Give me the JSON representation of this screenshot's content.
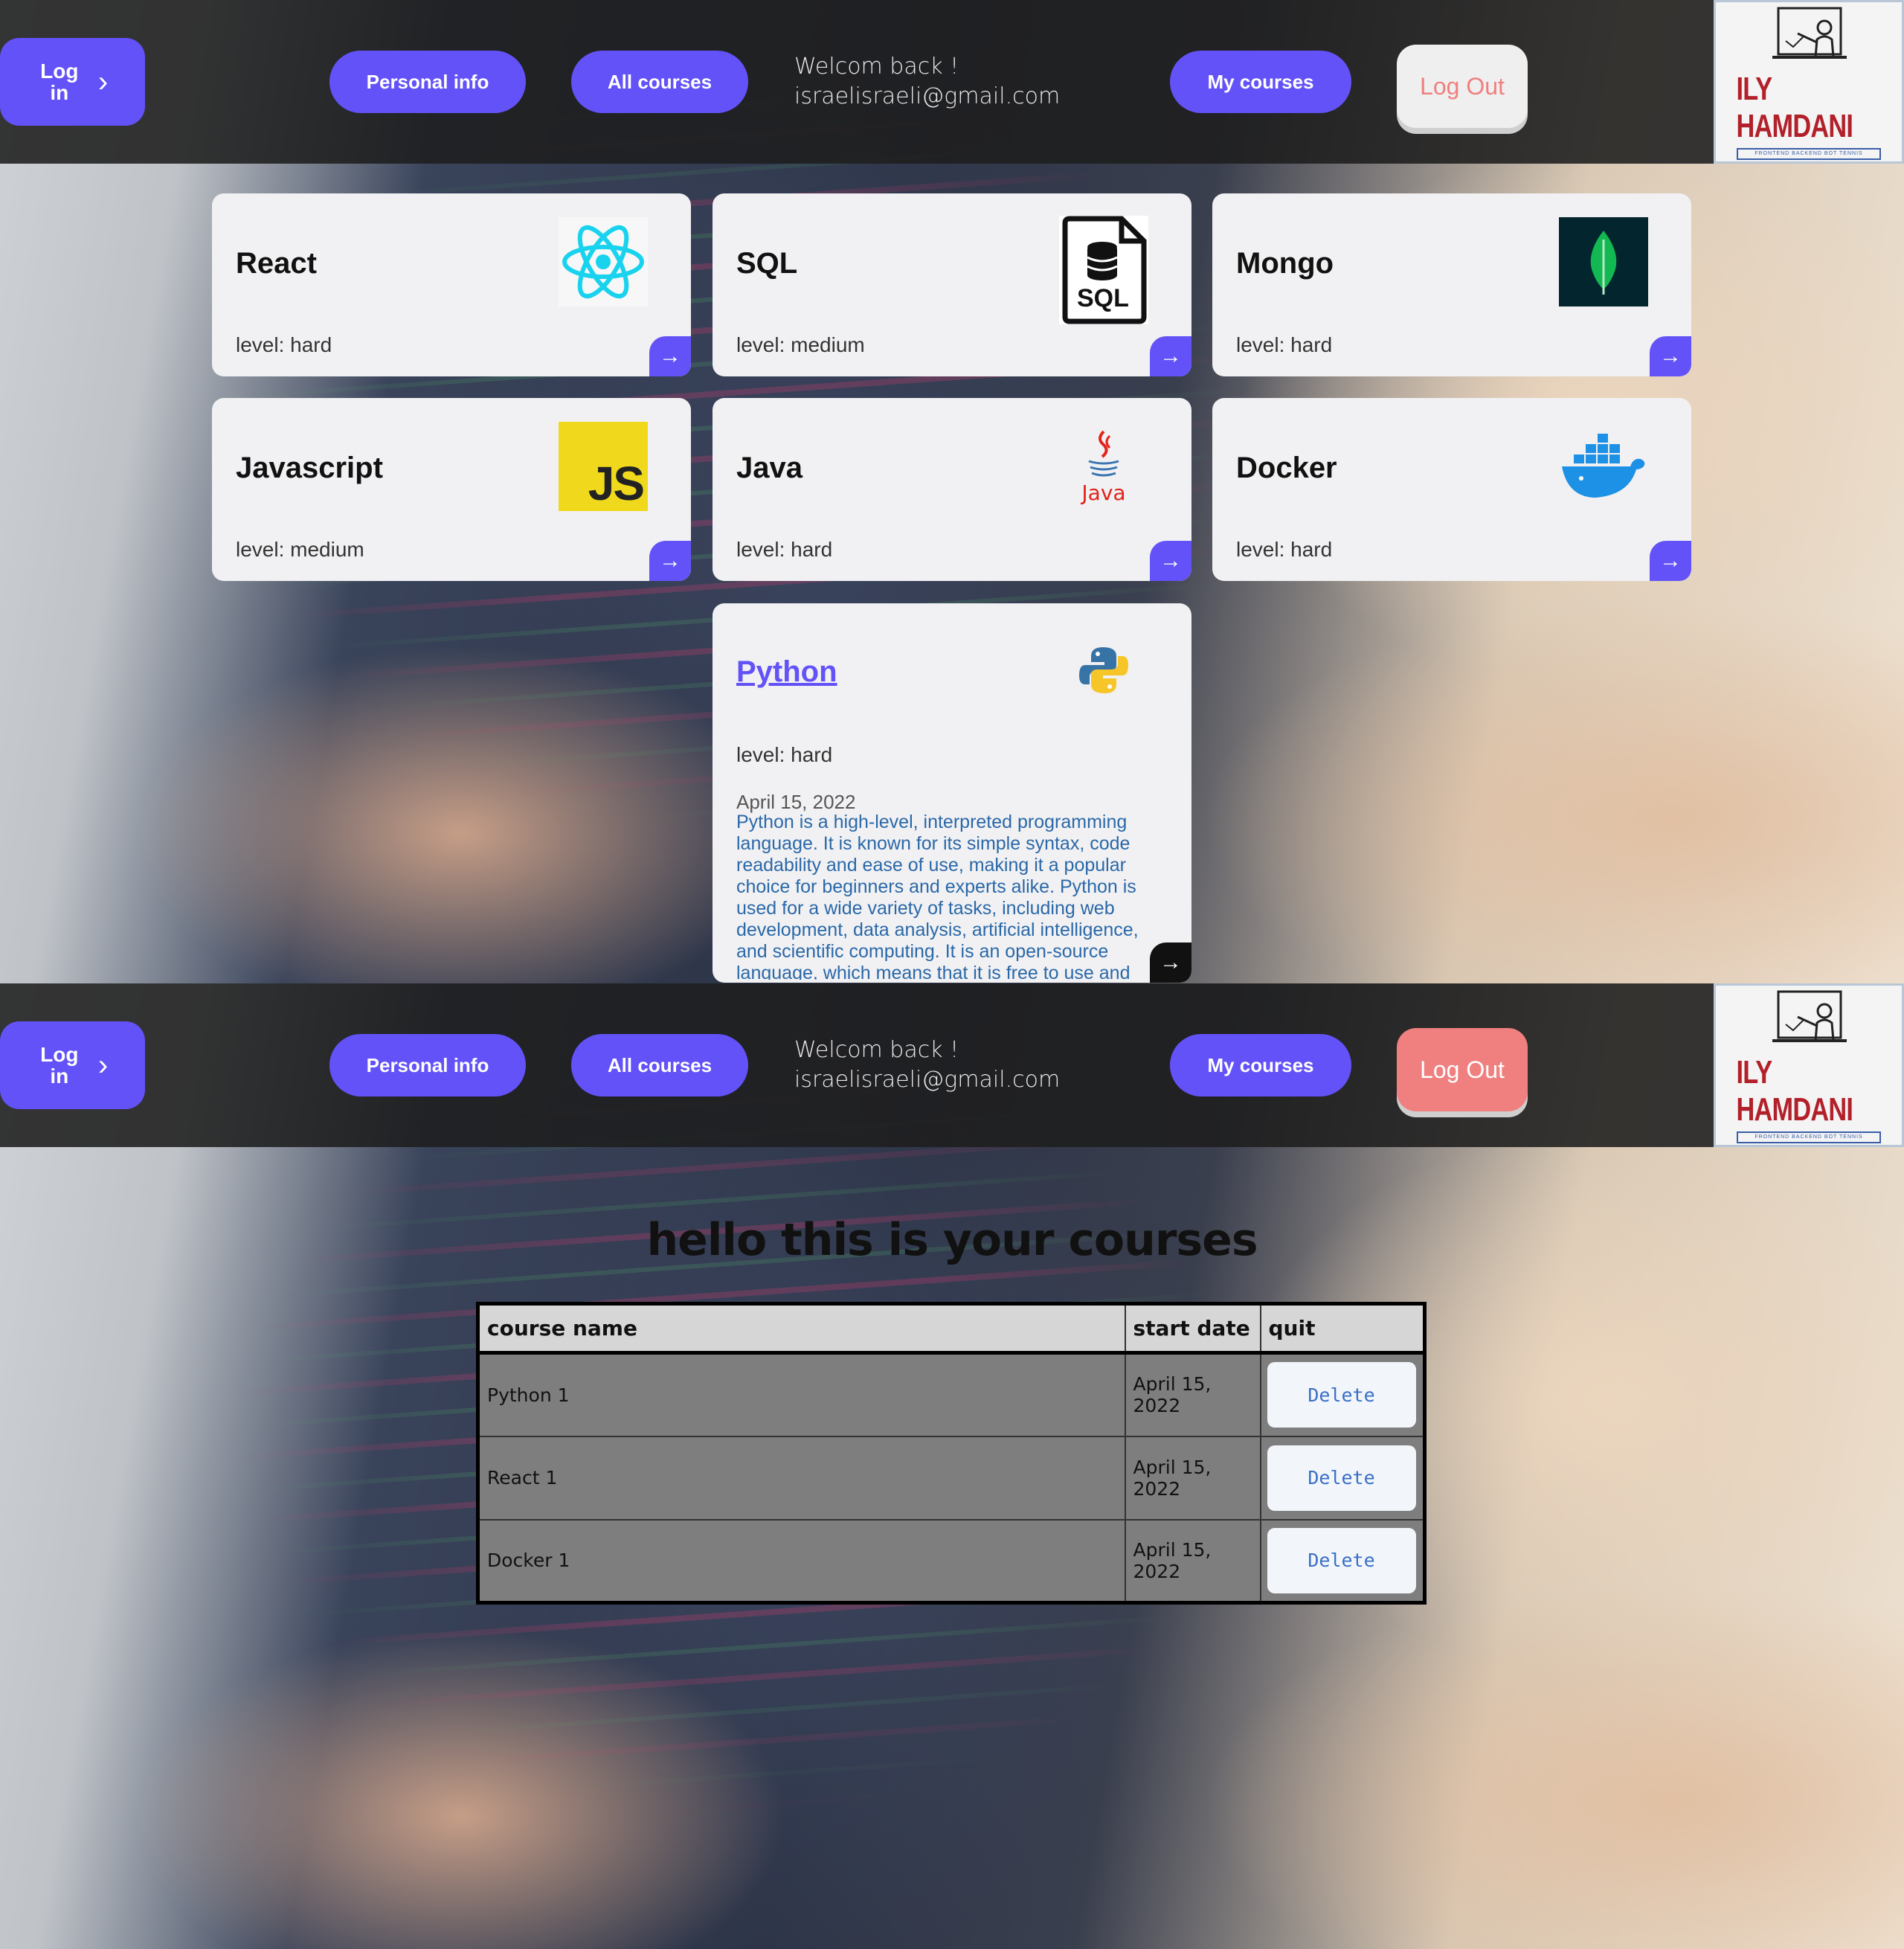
{
  "nav": {
    "login_label": "Log in",
    "login_chevron": "›",
    "personal_info": "Personal info",
    "all_courses": "All courses",
    "welcome": "Welcom back !",
    "email": "israelisraeli@gmail.com",
    "my_courses": "My courses",
    "logout": "Log Out",
    "logo_title": "ILY HAMDANI",
    "logo_subtitle": "FRONTEND BACKEND BOT TENNIS"
  },
  "courses": [
    {
      "name": "React",
      "level": "level: hard",
      "icon": "react-icon"
    },
    {
      "name": "SQL",
      "level": "level: medium",
      "icon": "sql-file-icon"
    },
    {
      "name": "Mongo",
      "level": "level: hard",
      "icon": "mongodb-leaf-icon"
    },
    {
      "name": "Javascript",
      "level": "level: medium",
      "icon": "js-icon"
    },
    {
      "name": "Java",
      "level": "level: hard",
      "icon": "java-cup-icon"
    },
    {
      "name": "Docker",
      "level": "level: hard",
      "icon": "docker-whale-icon"
    }
  ],
  "featured": {
    "name": "Python",
    "level": "level: hard",
    "date": "April 15, 2022",
    "description": "Python is a high-level, interpreted programming language. It is known for its simple syntax, code readability and ease of use, making it a popular choice for beginners and experts alike. Python is used for a wide variety of tasks, including web development, data analysis, artificial intelligence, and scientific computing. It is an open-source language, which means that it is free to use and",
    "icon": "python-icon"
  },
  "go_arrow": "→",
  "java_label": "Java",
  "js_label": "JS",
  "sql_label": "SQL",
  "my_courses_page": {
    "heading": "hello this is your courses",
    "columns": [
      "course name",
      "start date",
      "quit"
    ],
    "rows": [
      {
        "name": "Python 1",
        "date": "April 15, 2022",
        "action": "Delete"
      },
      {
        "name": "React 1",
        "date": "April 15, 2022",
        "action": "Delete"
      },
      {
        "name": "Docker 1",
        "date": "April 15, 2022",
        "action": "Delete"
      }
    ]
  },
  "colors": {
    "accent": "#6352f7",
    "logout_red": "#f08080",
    "logo_red": "#b2202a"
  }
}
